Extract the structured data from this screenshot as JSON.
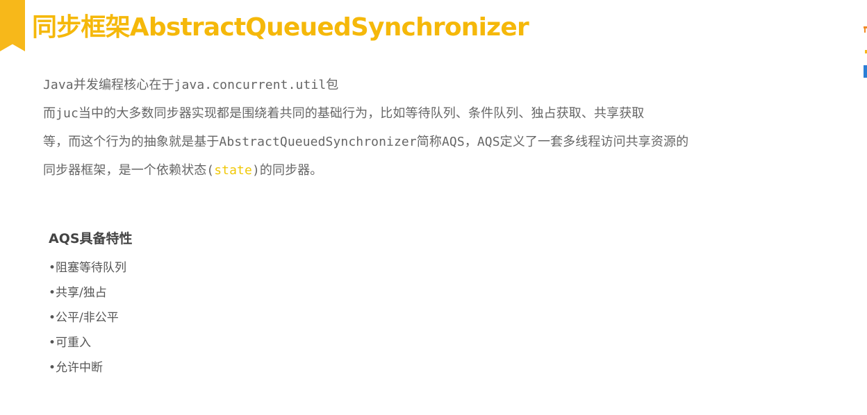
{
  "slide": {
    "title": "同步框架AbstractQueuedSynchronizer",
    "intro": {
      "line1": "Java并发编程核心在于java.concurrent.util包",
      "line2": "而juc当中的大多数同步器实现都是围绕着共同的基础行为，比如等待队列、条件队列、独占获取、共享获取",
      "line3": "等，而这个行为的抽象就是基于AbstractQueuedSynchronizer简称AQS，AQS定义了一套多线程访问共享资源的",
      "line4_before": "同步器框架，是一个依赖状态(",
      "line4_keyword": "state",
      "line4_after": ")的同步器。"
    },
    "features": {
      "heading": "AQS具备特性",
      "items": [
        "•阻塞等待队列",
        "•共享/独占",
        "•公平/非公平",
        "•可重入",
        "•允许中断"
      ]
    }
  },
  "colors": {
    "accent": "#f5b80a",
    "bookmark": "#f7b81a",
    "keyword": "#f0c808",
    "body_text": "#666666"
  }
}
